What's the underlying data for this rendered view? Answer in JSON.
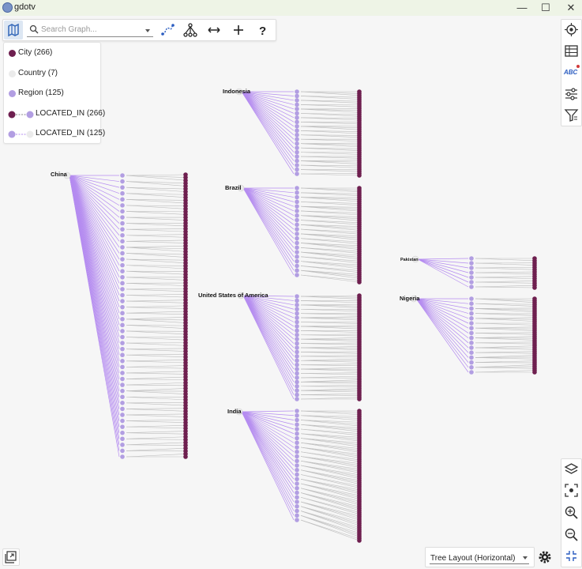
{
  "window": {
    "title": "gdotv",
    "minimize": "—",
    "maximize": "☐",
    "close": "✕"
  },
  "toolbar": {
    "search_placeholder": "Search Graph..."
  },
  "legend": {
    "items": [
      {
        "label": "City (266)",
        "color": "#6e1f4f"
      },
      {
        "label": "Country (7)",
        "color": "#ebebeb"
      },
      {
        "label": "Region (125)",
        "color": "#b29ee2"
      },
      {
        "label": "LOCATED_IN (266)",
        "from": "#6e1f4f",
        "to": "#b29ee2"
      },
      {
        "label": "LOCATED_IN (125)",
        "from": "#b29ee2",
        "to": "#ebebeb"
      }
    ]
  },
  "graph": {
    "countries": [
      {
        "label": "Indonesia"
      },
      {
        "label": "China"
      },
      {
        "label": "Brazil"
      },
      {
        "label": "United States of America"
      },
      {
        "label": "India"
      },
      {
        "label": "Pakistan"
      },
      {
        "label": "Nigeria"
      }
    ],
    "colors": {
      "city": "#6e1f4f",
      "region": "#b29ee2",
      "country": "#ebebeb",
      "region_edge": "#b58cf0",
      "city_edge": "#bdbdbd"
    }
  },
  "layout": {
    "selected": "Tree Layout (Horizontal)"
  }
}
